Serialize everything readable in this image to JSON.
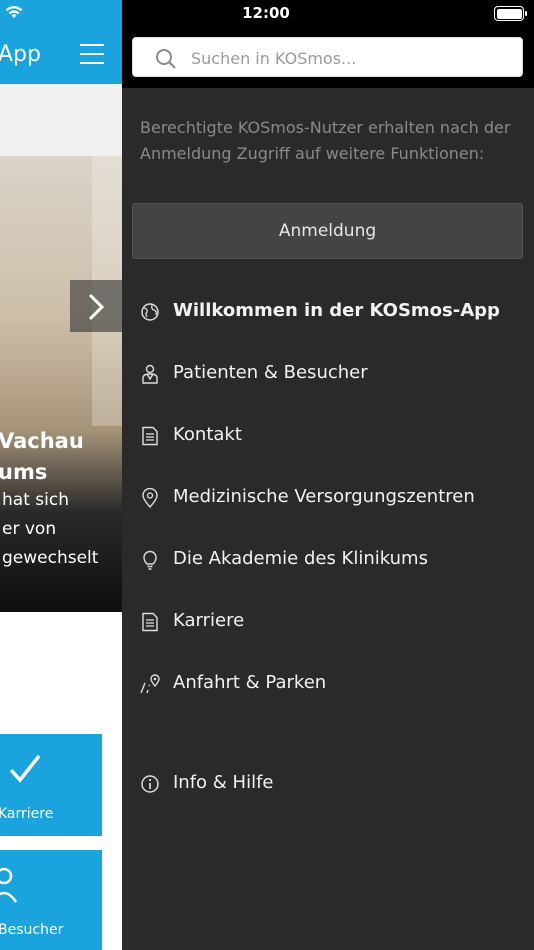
{
  "status_bar": {
    "time": "12:00"
  },
  "background_app": {
    "title": "App",
    "slide": {
      "title_lines": [
        "Vachau",
        "ums"
      ],
      "text_lines": [
        "hat sich",
        "er von",
        "gewechselt"
      ]
    },
    "tiles": [
      {
        "label": "Karriere",
        "icon": "checkmark-icon"
      },
      {
        "label": "Besucher",
        "icon": "person-icon"
      }
    ],
    "accent_color": "#1aa3dc"
  },
  "drawer": {
    "search": {
      "placeholder": "Suchen in KOSmos..."
    },
    "info_text": "Berechtigte KOSmos-Nutzer erhalten nach der Anmeldung Zugriff auf weitere Funktionen:",
    "login_label": "Anmeldung",
    "menu": [
      {
        "label": "Willkommen in der KOSmos-App",
        "icon": "globe-icon"
      },
      {
        "label": "Patienten & Besucher",
        "icon": "patient-icon"
      },
      {
        "label": "Kontakt",
        "icon": "document-icon"
      },
      {
        "label": "Medizinische Versorgungszentren",
        "icon": "location-pin-icon"
      },
      {
        "label": "Die Akademie des Klinikums",
        "icon": "lightbulb-icon"
      },
      {
        "label": "Karriere",
        "icon": "document-icon"
      },
      {
        "label": "Anfahrt & Parken",
        "icon": "route-icon"
      },
      {
        "label": "Info & Hilfe",
        "icon": "info-icon"
      }
    ],
    "background_color": "#2a2a2a"
  }
}
